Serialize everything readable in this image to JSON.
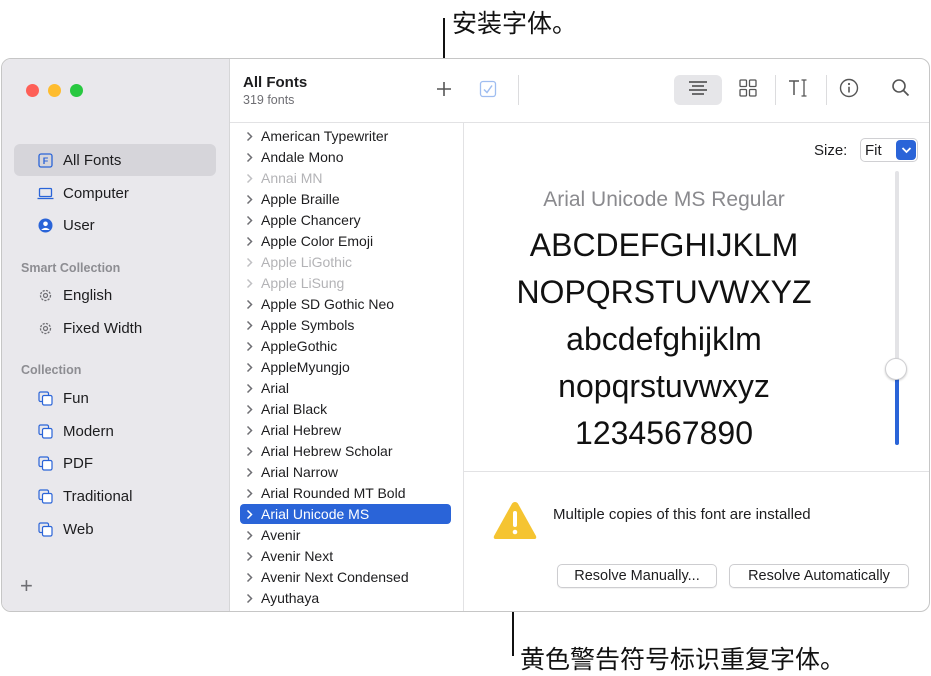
{
  "callouts": {
    "top": "安装字体。",
    "bottom": "黄色警告符号标识重复字体。"
  },
  "sidebar": {
    "items": [
      {
        "label": "All Fonts",
        "icon": "font-box-icon",
        "selected": true
      },
      {
        "label": "Computer",
        "icon": "laptop-icon"
      },
      {
        "label": "User",
        "icon": "user-circle-icon"
      }
    ],
    "smart_collection_header": "Smart Collection",
    "smart_collections": [
      {
        "label": "English",
        "icon": "gear-icon"
      },
      {
        "label": "Fixed Width",
        "icon": "gear-icon"
      }
    ],
    "collection_header": "Collection",
    "collections": [
      {
        "label": "Fun",
        "icon": "collection-icon"
      },
      {
        "label": "Modern",
        "icon": "collection-icon"
      },
      {
        "label": "PDF",
        "icon": "collection-icon"
      },
      {
        "label": "Traditional",
        "icon": "collection-icon"
      },
      {
        "label": "Web",
        "icon": "collection-icon"
      }
    ],
    "add_label": "+"
  },
  "toolbar": {
    "title": "All Fonts",
    "subtitle": "319 fonts"
  },
  "fonts": [
    {
      "name": "American Typewriter"
    },
    {
      "name": "Andale Mono"
    },
    {
      "name": "Annai MN",
      "disabled": true
    },
    {
      "name": "Apple Braille"
    },
    {
      "name": "Apple Chancery"
    },
    {
      "name": "Apple Color Emoji"
    },
    {
      "name": "Apple LiGothic",
      "disabled": true
    },
    {
      "name": "Apple LiSung",
      "disabled": true
    },
    {
      "name": "Apple SD Gothic Neo"
    },
    {
      "name": "Apple Symbols"
    },
    {
      "name": "AppleGothic"
    },
    {
      "name": "AppleMyungjo"
    },
    {
      "name": "Arial"
    },
    {
      "name": "Arial Black"
    },
    {
      "name": "Arial Hebrew"
    },
    {
      "name": "Arial Hebrew Scholar"
    },
    {
      "name": "Arial Narrow"
    },
    {
      "name": "Arial Rounded MT Bold"
    },
    {
      "name": "Arial Unicode MS",
      "selected": true
    },
    {
      "name": "Avenir"
    },
    {
      "name": "Avenir Next"
    },
    {
      "name": "Avenir Next Condensed"
    },
    {
      "name": "Ayuthaya"
    }
  ],
  "preview": {
    "size_label": "Size:",
    "size_value": "Fit",
    "font_name": "Arial Unicode MS Regular",
    "lines": [
      "ABCDEFGHIJKLM",
      "NOPQRSTUVWXYZ",
      "abcdefghijklm",
      "nopqrstuvwxyz",
      "1234567890"
    ],
    "slider_level": 0.2
  },
  "warning": {
    "message": "Multiple copies of this font are installed",
    "resolve_manually": "Resolve Manually...",
    "resolve_automatically": "Resolve Automatically"
  },
  "colors": {
    "accent": "#2a64d8",
    "warning": "#f5c431"
  }
}
